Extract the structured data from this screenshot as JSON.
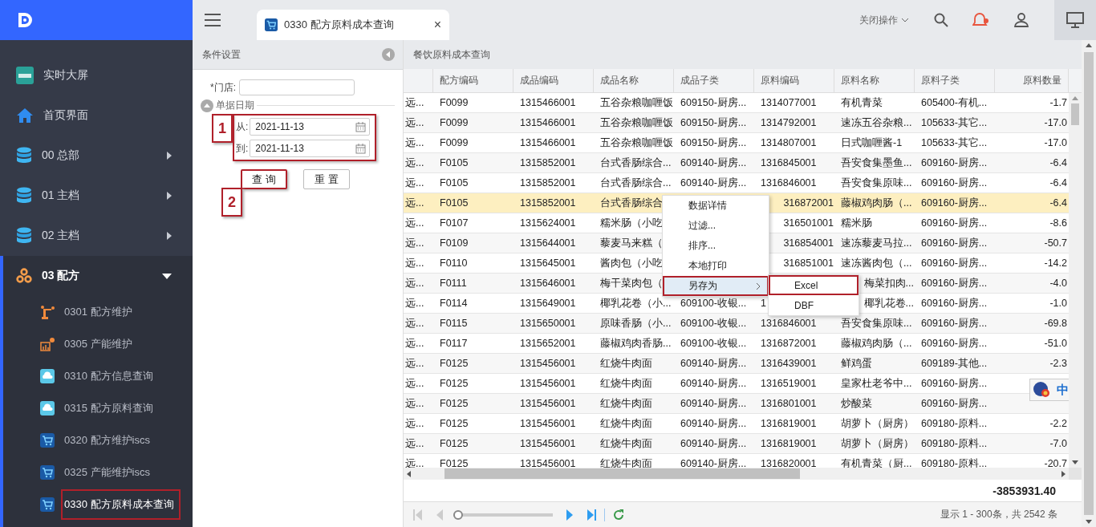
{
  "sidebar": {
    "items": [
      {
        "label": "实时大屏",
        "kind": "data",
        "has_children": false,
        "expanded": false
      },
      {
        "label": "首页界面",
        "kind": "home",
        "has_children": false,
        "expanded": false
      },
      {
        "label": "00 总部",
        "kind": "db",
        "has_children": true,
        "expanded": false
      },
      {
        "label": "01 主档",
        "kind": "db",
        "has_children": true,
        "expanded": false
      },
      {
        "label": "02 主档",
        "kind": "db",
        "has_children": true,
        "expanded": false
      },
      {
        "label": "03 配方",
        "kind": "recipe",
        "has_children": true,
        "expanded": true,
        "children": [
          {
            "label": "0301 配方维护",
            "kind": "robot",
            "selected": false,
            "highlighted": false
          },
          {
            "label": "0305 产能维护",
            "kind": "chart",
            "selected": false,
            "highlighted": false
          },
          {
            "label": "0310 配方信息查询",
            "kind": "cloud",
            "selected": false,
            "highlighted": false
          },
          {
            "label": "0315 配方原料查询",
            "kind": "cloud",
            "selected": false,
            "highlighted": false
          },
          {
            "label": "0320 配方维护iscs",
            "kind": "cart",
            "selected": false,
            "highlighted": false
          },
          {
            "label": "0325 产能维护iscs",
            "kind": "cart",
            "selected": false,
            "highlighted": false
          },
          {
            "label": "0330 配方原料成本查询",
            "kind": "cart",
            "selected": true,
            "highlighted": true
          }
        ]
      }
    ]
  },
  "tabs": [
    {
      "label": "0330 配方原料成本查询",
      "selected": true,
      "close": "×"
    }
  ],
  "top_bar": {
    "close_ops": "关闭操作",
    "notification": true
  },
  "filter_panel": {
    "title": "条件设置",
    "store_label": "*门店:",
    "date_section": "单据日期",
    "from_label": "从:",
    "from_value": "2021-11-13",
    "to_label": "到:",
    "to_value": "2021-11-13",
    "dates_highlighted": true,
    "dates_callout": "1",
    "buttons": [
      {
        "label": "查 询",
        "highlighted": true,
        "callout": "2"
      },
      {
        "label": "重 置",
        "highlighted": false
      }
    ]
  },
  "grid": {
    "title": "餐饮原料成本查询",
    "columns": [
      "",
      "配方编码",
      "成品编码",
      "成品名称",
      "成品子类",
      "原料编码",
      "原料名称",
      "原料子类",
      "原料数量"
    ],
    "rows": [
      {
        "selected": false,
        "cells": [
          "远...",
          "F0099",
          "1315466001",
          "五谷杂粮咖喱饭",
          "609150-厨房...",
          "1314077001",
          "有机青菜",
          "605400-有机...",
          "-1.7"
        ]
      },
      {
        "selected": false,
        "cells": [
          "远...",
          "F0099",
          "1315466001",
          "五谷杂粮咖喱饭",
          "609150-厨房...",
          "1314792001",
          "速冻五谷杂粮...",
          "105633-其它...",
          "-17.0"
        ]
      },
      {
        "selected": false,
        "cells": [
          "远...",
          "F0099",
          "1315466001",
          "五谷杂粮咖喱饭",
          "609150-厨房...",
          "1314807001",
          "日式咖喱酱-1",
          "105633-其它...",
          "-17.0"
        ]
      },
      {
        "selected": false,
        "cells": [
          "远...",
          "F0105",
          "1315852001",
          "台式香肠综合...",
          "609140-厨房...",
          "1316845001",
          "吾安食集墨鱼...",
          "609160-厨房...",
          "-6.4"
        ]
      },
      {
        "selected": false,
        "cells": [
          "远...",
          "F0105",
          "1315852001",
          "台式香肠综合...",
          "609140-厨房...",
          "1316846001",
          "吾安食集原味...",
          "609160-厨房...",
          "-6.4"
        ]
      },
      {
        "selected": true,
        "cells": [
          "远...",
          "F0105",
          "1315852001",
          "台式香肠综合",
          null,
          {
            "text": "316872001",
            "clipped_left": true
          },
          "藤椒鸡肉肠（...",
          "609160-厨房...",
          "-6.4"
        ]
      },
      {
        "selected": false,
        "cells": [
          "远...",
          "F0107",
          "1315624001",
          "糯米肠（小吃",
          null,
          {
            "text": "316501001",
            "clipped_left": true
          },
          "糯米肠",
          "609160-厨房...",
          "-8.6"
        ]
      },
      {
        "selected": false,
        "cells": [
          "远...",
          "F0109",
          "1315644001",
          "藜麦马来糕（",
          null,
          {
            "text": "316854001",
            "clipped_left": true
          },
          "速冻藜麦马拉...",
          "609160-厨房...",
          "-50.7"
        ]
      },
      {
        "selected": false,
        "cells": [
          "远...",
          "F0110",
          "1315645001",
          "酱肉包（小吃",
          null,
          {
            "text": "316851001",
            "clipped_left": true
          },
          "速冻酱肉包（...",
          "609160-厨房...",
          "-14.2"
        ]
      },
      {
        "selected": false,
        "cells": [
          "远...",
          "F0111",
          "1315646001",
          "梅干菜肉包（",
          null,
          null,
          {
            "text": "梅菜扣肉...",
            "clipped_left": true
          },
          "609160-厨房...",
          "-4.0"
        ]
      },
      {
        "selected": false,
        "cells": [
          "远...",
          "F0114",
          "1315649001",
          "椰乳花卷（小...",
          "609100-收银...",
          "1",
          {
            "text": "椰乳花卷...",
            "clipped_left": true
          },
          "609160-厨房...",
          "-1.0"
        ]
      },
      {
        "selected": false,
        "cells": [
          "远...",
          "F0115",
          "1315650001",
          "原味香肠（小...",
          "609100-收银...",
          "1316846001",
          "吾安食集原味...",
          "609160-厨房...",
          "-69.8"
        ]
      },
      {
        "selected": false,
        "cells": [
          "远...",
          "F0117",
          "1315652001",
          "藤椒鸡肉香肠...",
          "609100-收银...",
          "1316872001",
          "藤椒鸡肉肠（...",
          "609160-厨房...",
          "-51.0"
        ]
      },
      {
        "selected": false,
        "cells": [
          "远...",
          "F0125",
          "1315456001",
          "红烧牛肉面",
          "609140-厨房...",
          "1316439001",
          "鲜鸡蛋",
          "609189-其他...",
          "-2.3"
        ]
      },
      {
        "selected": false,
        "cells": [
          "远...",
          "F0125",
          "1315456001",
          "红烧牛肉面",
          "609140-厨房...",
          "1316519001",
          "皇家杜老爷中...",
          "609160-厨房...",
          null
        ]
      },
      {
        "selected": false,
        "cells": [
          "远...",
          "F0125",
          "1315456001",
          "红烧牛肉面",
          "609140-厨房...",
          "1316801001",
          "炒酸菜",
          "609160-厨房...",
          null
        ]
      },
      {
        "selected": false,
        "cells": [
          "远...",
          "F0125",
          "1315456001",
          "红烧牛肉面",
          "609140-厨房...",
          "1316819001",
          "胡萝卜（厨房）",
          "609180-原料...",
          "-2.2"
        ]
      },
      {
        "selected": false,
        "cells": [
          "远...",
          "F0125",
          "1315456001",
          "红烧牛肉面",
          "609140-厨房...",
          "1316819001",
          "胡萝卜（厨房）",
          "609180-原料...",
          "-7.0"
        ]
      },
      {
        "selected": false,
        "cells": [
          "远...",
          "F0125",
          "1315456001",
          "红烧牛肉面",
          "609140-厨房...",
          "1316820001",
          "有机青菜（厨...",
          "609180-原料...",
          "-20.7"
        ]
      }
    ],
    "total": "-3853931.40",
    "pager": {
      "level": 0.0,
      "summary": "显示 1 - 300条，共 2542 条"
    }
  },
  "context_menu": {
    "items": [
      {
        "label": "数据详情",
        "selected": false,
        "has_submenu": false
      },
      {
        "label": "过滤...",
        "selected": false,
        "has_submenu": false
      },
      {
        "label": "排序...",
        "selected": false,
        "has_submenu": false
      },
      {
        "label": "本地打印",
        "selected": false,
        "has_submenu": false
      },
      {
        "label": "另存为",
        "selected": true,
        "has_submenu": true
      }
    ],
    "submenu": [
      {
        "label": "Excel",
        "highlighted": true
      },
      {
        "label": "DBF",
        "highlighted": false
      }
    ]
  },
  "ime": {
    "label": "中"
  }
}
